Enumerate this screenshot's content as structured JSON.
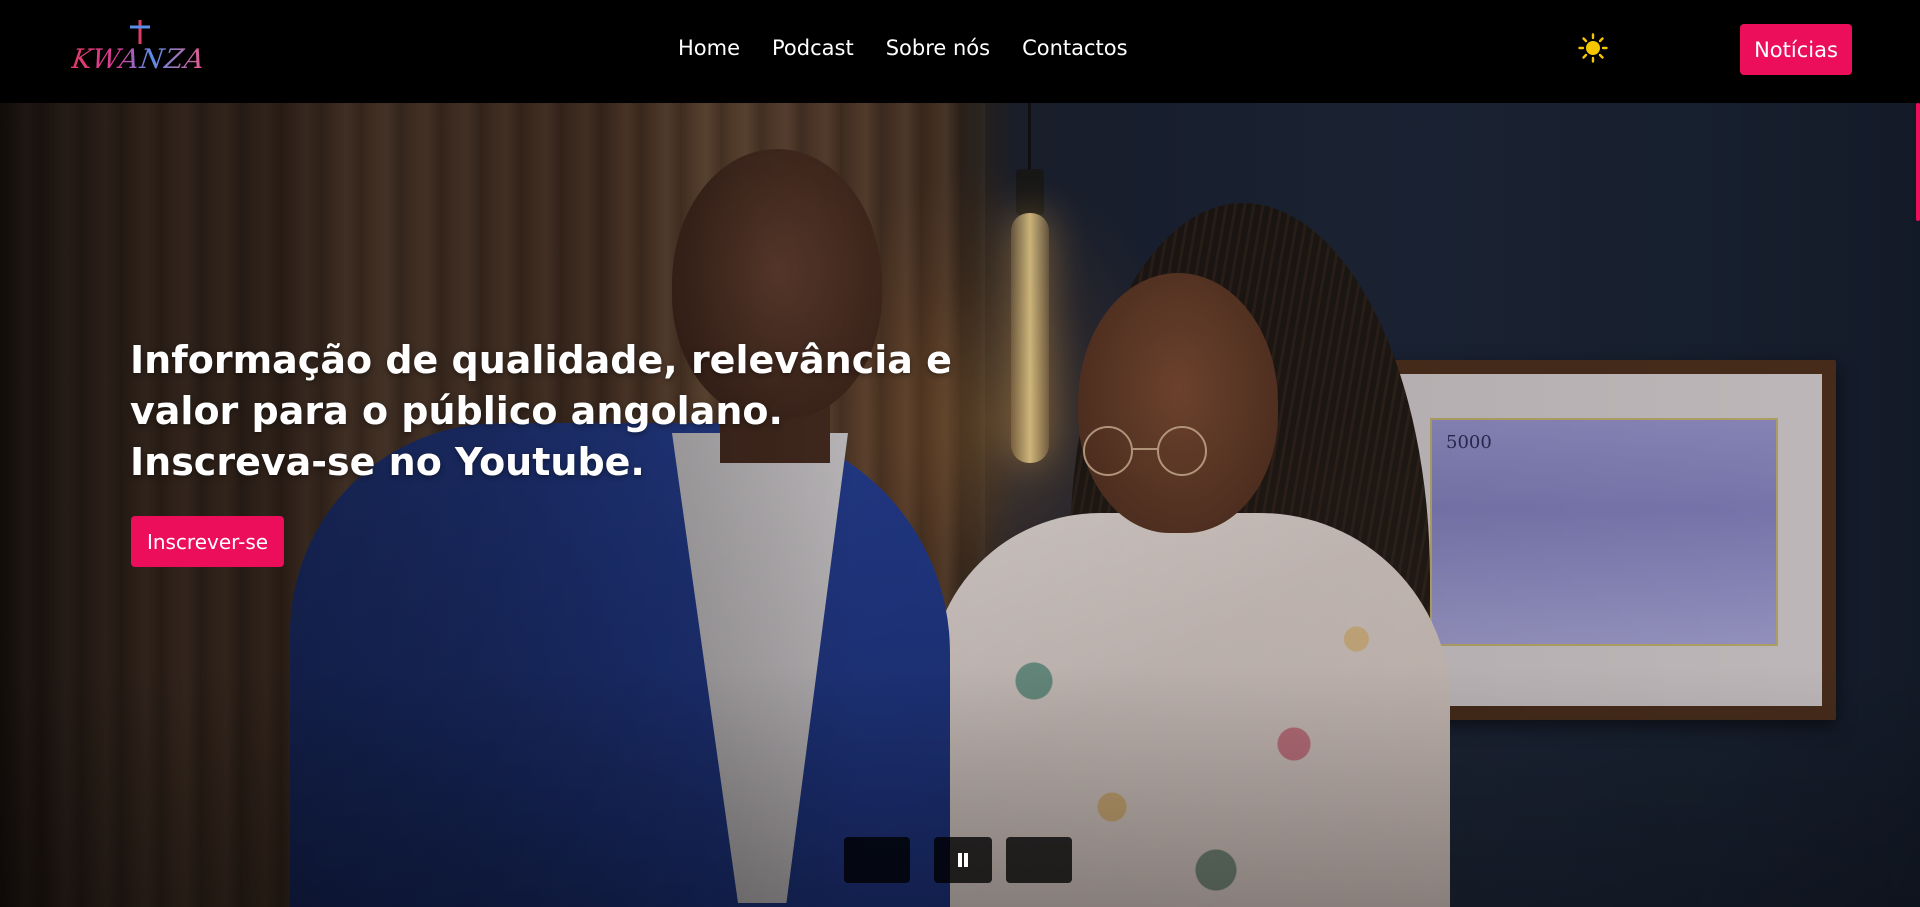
{
  "header": {
    "logo_text": "KWANZA",
    "nav": [
      {
        "label": "Home"
      },
      {
        "label": "Podcast"
      },
      {
        "label": "Sobre nós"
      },
      {
        "label": "Contactos"
      }
    ],
    "theme_toggle_icon": "sun-icon",
    "news_button_label": "Notícias"
  },
  "hero": {
    "heading": "Informação de qualidade, relevância e valor para o público angolano. Inscreva-se no Youtube.",
    "subscribe_label": "Inscrever-se",
    "picture_note_value": "5000",
    "slider": {
      "prev_icon": "chevron-left-icon",
      "pause_icon": "pause-icon",
      "next_icon": "chevron-right-icon"
    }
  },
  "colors": {
    "accent": "#ec0e5b",
    "header_bg": "#000000",
    "sun": "#f6c700"
  }
}
